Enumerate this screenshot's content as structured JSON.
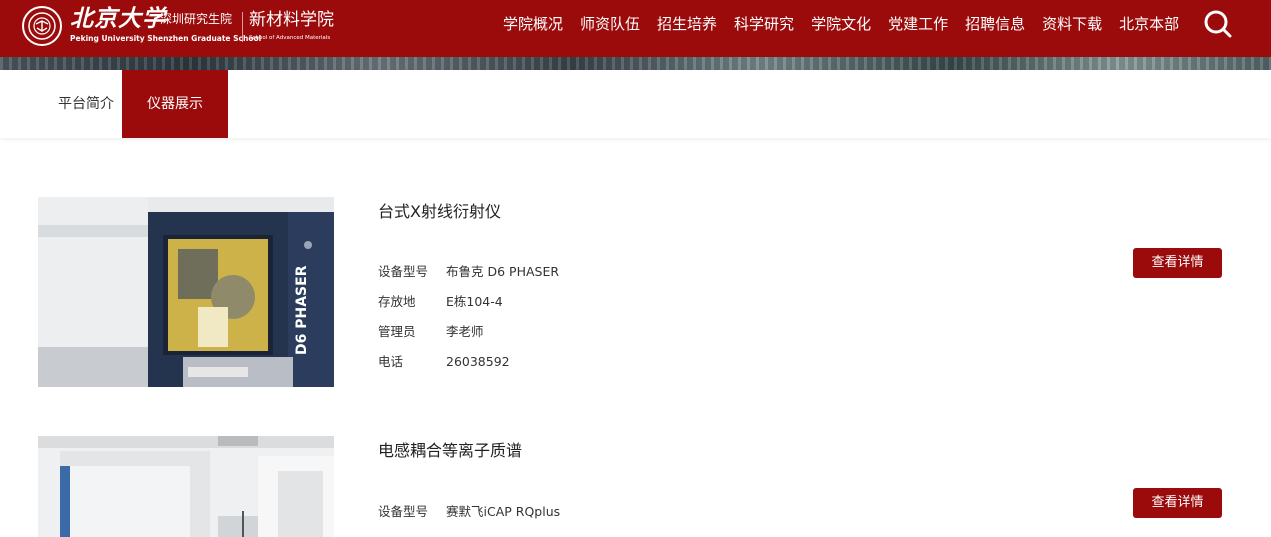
{
  "header": {
    "brand_cn": "北京大学",
    "brand_sub": "深圳研究生院",
    "brand_en": "Peking University Shenzhen Graduate School",
    "school_cn": "新材料学院",
    "school_en": "School of Advanced Materials",
    "nav": [
      "学院概况",
      "师资队伍",
      "招生培养",
      "科学研究",
      "学院文化",
      "党建工作",
      "招聘信息",
      "资料下载",
      "北京本部"
    ],
    "search_icon": "search-icon",
    "colors": {
      "brand_red": "#9b0b0b"
    }
  },
  "subnav": {
    "tabs": [
      "平台简介",
      "仪器展示"
    ],
    "active_index": 1
  },
  "instruments": [
    {
      "name": "台式X射线衍射仪",
      "specs": [
        {
          "label": "设备型号",
          "value": "布鲁克 D6 PHASER"
        },
        {
          "label": "存放地",
          "value": "E栋104-4"
        },
        {
          "label": "管理员",
          "value": "李老师"
        },
        {
          "label": "电话",
          "value": "26038592"
        }
      ],
      "image_text": "D6 PHASER",
      "button": "查看详情"
    },
    {
      "name": "电感耦合等离子质谱",
      "specs": [
        {
          "label": "设备型号",
          "value": "赛默飞iCAP RQplus"
        }
      ],
      "button": "查看详情"
    }
  ]
}
